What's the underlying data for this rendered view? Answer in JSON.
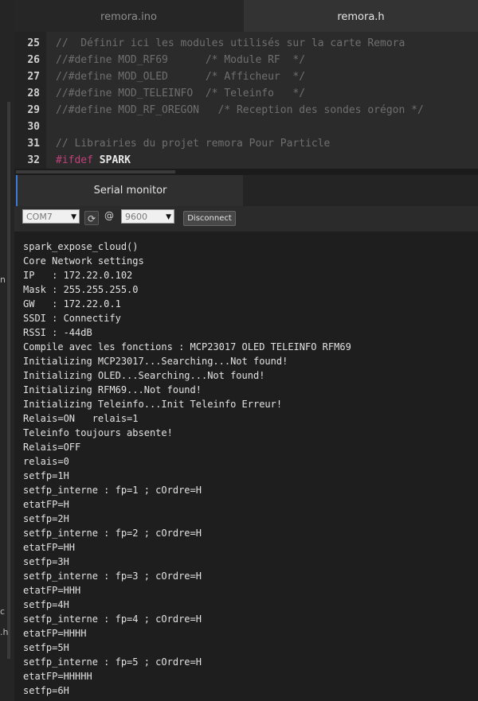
{
  "tabs": [
    {
      "label": "remora.ino",
      "active": false
    },
    {
      "label": "remora.h",
      "active": true
    }
  ],
  "sidebar_fragments": [
    "n",
    "c",
    ".h"
  ],
  "editor": {
    "lines": [
      {
        "num": "25",
        "code": [
          {
            "t": "//  Définir ici les modules utilisés sur la carte Remora",
            "c": "cmt"
          }
        ]
      },
      {
        "num": "26",
        "code": [
          {
            "t": "//#define MOD_RF69      /* Module RF  */",
            "c": "cmt"
          }
        ]
      },
      {
        "num": "27",
        "code": [
          {
            "t": "//#define MOD_OLED      /* Afficheur  */",
            "c": "cmt"
          }
        ]
      },
      {
        "num": "28",
        "code": [
          {
            "t": "//#define MOD_TELEINFO  /* Teleinfo   */",
            "c": "cmt"
          }
        ]
      },
      {
        "num": "29",
        "code": [
          {
            "t": "//#define MOD_RF_OREGON   /* Reception des sondes orégon */",
            "c": "cmt"
          }
        ]
      },
      {
        "num": "30",
        "code": []
      },
      {
        "num": "31",
        "code": [
          {
            "t": "// Librairies du projet remora Pour Particle",
            "c": "cmt"
          }
        ]
      },
      {
        "num": "32",
        "code": [
          {
            "t": "#ifdef ",
            "c": "dir"
          },
          {
            "t": "SPARK",
            "c": "kw"
          }
        ]
      }
    ]
  },
  "serial_monitor": {
    "title": "Serial monitor",
    "port": "COM7",
    "at": "@",
    "baud": "9600",
    "disconnect_label": "Disconnect",
    "output": [
      "spark_expose_cloud()",
      "Core Network settings",
      "IP   : 172.22.0.102",
      "Mask : 255.255.255.0",
      "GW   : 172.22.0.1",
      "SSDI : Connectify",
      "RSSI : -44dB",
      "Compile avec les fonctions : MCP23017 OLED TELEINFO RFM69",
      "Initializing MCP23017...Searching...Not found!",
      "Initializing OLED...Searching...Not found!",
      "Initializing RFM69...Not found!",
      "Initializing Teleinfo...Init Teleinfo Erreur!",
      "Relais=ON   relais=1",
      "Teleinfo toujours absente!",
      "Relais=OFF",
      "relais=0",
      "setfp=1H",
      "setfp_interne : fp=1 ; cOrdre=H",
      "etatFP=H",
      "setfp=2H",
      "setfp_interne : fp=2 ; cOrdre=H",
      "etatFP=HH",
      "setfp=3H",
      "setfp_interne : fp=3 ; cOrdre=H",
      "etatFP=HHH",
      "setfp=4H",
      "setfp_interne : fp=4 ; cOrdre=H",
      "etatFP=HHHH",
      "setfp=5H",
      "setfp_interne : fp=5 ; cOrdre=H",
      "etatFP=HHHHH",
      "setfp=6H"
    ]
  },
  "colors": {
    "accent": "#3a7bd5",
    "comment": "#6f6f6f",
    "directive": "#c0407a"
  }
}
